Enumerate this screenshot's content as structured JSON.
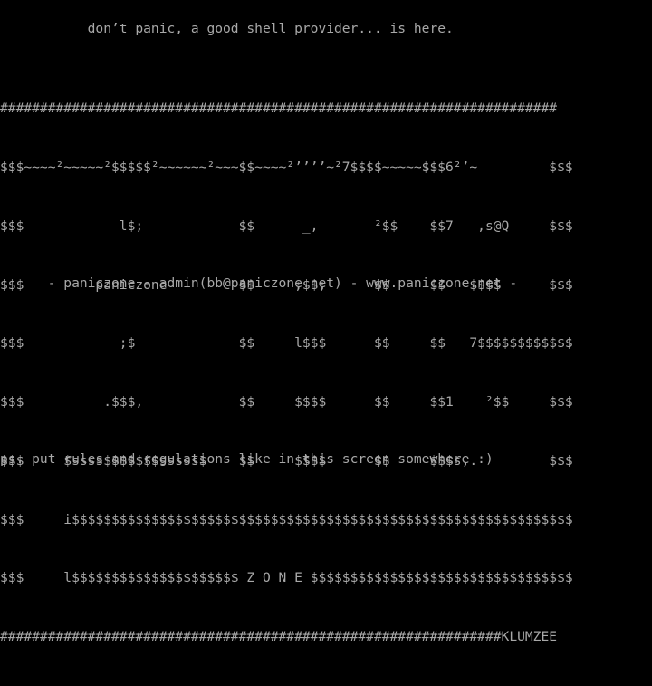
{
  "screen": {
    "tagline": "           don’t panic, a good shell provider... is here.",
    "banner_lines": [
      "######################################################################",
      "$$$~~~~²~~~~~²$$$$$²~~~~~~²~~~$$~~~~²’’’’~²7$$$$~~~~~$$$6²’~         $$$",
      "$$$            l$;            $$      _,       ²$$    $$7   ,s@Q     $$$",
      "$$$         paniczone         $$     ;$$;      $$     $$   $$$$      $$$",
      "$$$            ;$             $$     l$$$      $$     $$   7$$$$$$$$$$$$",
      "$$$          .$$$,            $$     $$$$      $$     $$1    ²$$     $$$",
      "$$$     $ssss$$$$$$$sssss$    $$     $$$$      $$     $$$s,.         $$$",
      "$$$     i$$$$$$$$$$$$$$$$$$$$$$$$$$$$$$$$$$$$$$$$$$$$$$$$$$$$$$$$$$$$$$$",
      "$$$     l$$$$$$$$$$$$$$$$$$$$$ Z O N E $$$$$$$$$$$$$$$$$$$$$$$$$$$$$$$$$",
      "###############################################################KLUMZEE"
    ],
    "contact_line": "      - paniczone - admin(bb@paniczone.net) - www.paniczone.net -",
    "footer_note": "ps. put rules and regulations like in this screen somewhere :)"
  },
  "colors": {
    "background": "#000000",
    "text": "#a8a8a8"
  }
}
